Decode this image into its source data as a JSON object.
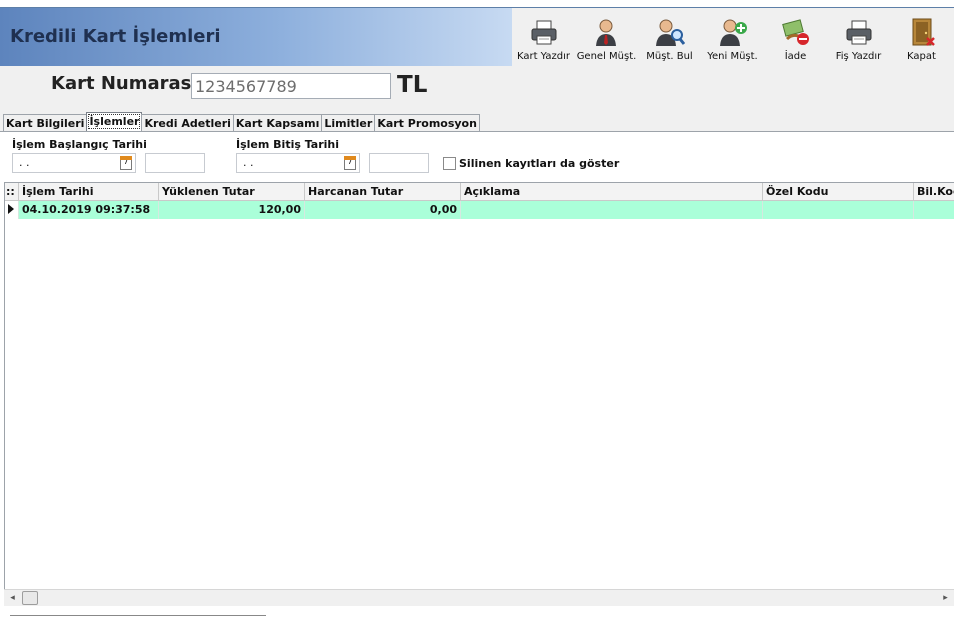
{
  "header": {
    "title": "Kredili Kart İşlemleri"
  },
  "toolbar": {
    "buttons": [
      {
        "label": "Kart Yazdır",
        "icon": "printer-icon"
      },
      {
        "label": "Genel Müşt.",
        "icon": "person-icon"
      },
      {
        "label": "Müşt. Bul",
        "icon": "person-search-icon"
      },
      {
        "label": "Yeni Müşt.",
        "icon": "person-add-icon"
      },
      {
        "label": "İade",
        "icon": "refund-icon"
      },
      {
        "label": "Fiş Yazdır",
        "icon": "printer-icon"
      },
      {
        "label": "Kapat",
        "icon": "exit-door-icon"
      }
    ]
  },
  "card": {
    "label": "Kart Numarası",
    "value": "1234567789",
    "currency": "TL"
  },
  "tabs": [
    {
      "label": "Kart Bilgileri",
      "active": false
    },
    {
      "label": "İşlemler",
      "active": true
    },
    {
      "label": "Kredi Adetleri",
      "active": false
    },
    {
      "label": "Kart Kapsamı",
      "active": false
    },
    {
      "label": "Limitler",
      "active": false
    },
    {
      "label": "Kart Promosyon",
      "active": false
    }
  ],
  "filters": {
    "start_label": "İşlem Başlangıç Tarihi",
    "start_value": " . .",
    "end_label": "İşlem Bitiş Tarihi",
    "end_value": " . .",
    "calendar_day": "7",
    "show_deleted_label": "Silinen kayıtları da göster",
    "show_deleted": false
  },
  "grid": {
    "indicator": "::",
    "columns": [
      "İşlem Tarihi",
      "Yüklenen Tutar",
      "Harcanan Tutar",
      "Açıklama",
      "Özel Kodu",
      "Bil.Kodu"
    ],
    "rows": [
      {
        "date": "04.10.2019 09:37:58",
        "loaded": "120,00",
        "spent": "0,00",
        "description": "",
        "special_code": "",
        "bil_code": ""
      }
    ]
  },
  "colors": {
    "header_start": "#5d84bd",
    "selected_row": "#aaffd9"
  }
}
